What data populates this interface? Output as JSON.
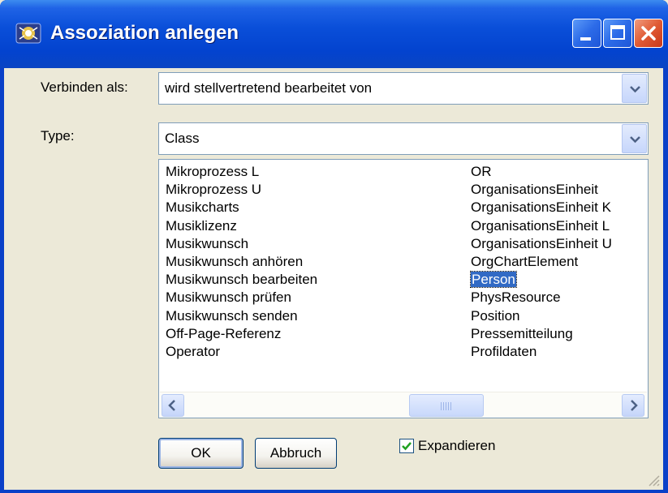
{
  "window": {
    "title": "Assoziation anlegen"
  },
  "form": {
    "verbinden_label": "Verbinden als:",
    "verbinden_value": "wird stellvertretend bearbeitet von",
    "type_label": "Type:",
    "type_value": "Class"
  },
  "list": {
    "left": [
      "Mikroprozess L",
      "Mikroprozess U",
      "Musikcharts",
      "Musiklizenz",
      "Musikwunsch",
      "Musikwunsch anhören",
      "Musikwunsch bearbeiten",
      "Musikwunsch prüfen",
      "Musikwunsch senden",
      "Off-Page-Referenz",
      "Operator"
    ],
    "right": [
      "OR",
      "OrganisationsEinheit",
      "OrganisationsEinheit K",
      "OrganisationsEinheit L",
      "OrganisationsEinheit U",
      "OrgChartElement",
      "Person",
      "PhysResource",
      "Position",
      "Pressemitteilung",
      "Profildaten"
    ],
    "selected": "Person"
  },
  "buttons": {
    "ok": "OK",
    "cancel": "Abbruch"
  },
  "checkbox": {
    "label": "Expandieren",
    "checked": true
  },
  "colors": {
    "titlebar": "#0A4FD9",
    "dialog_bg": "#ECE9D8",
    "selection": "#316AC5"
  }
}
